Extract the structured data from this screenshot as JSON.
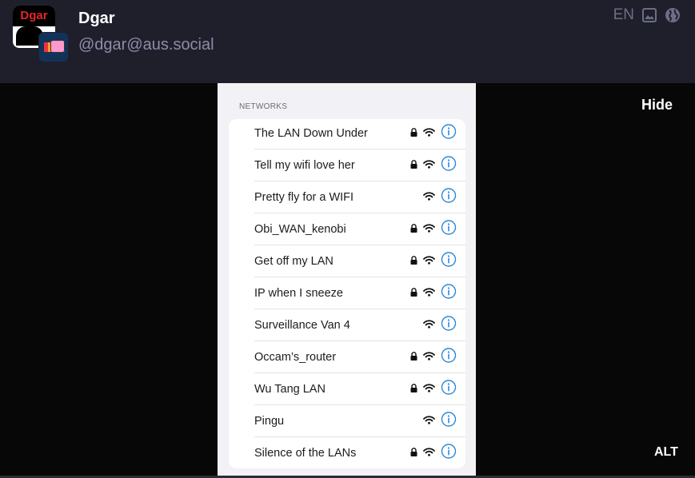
{
  "post": {
    "display_name": "Dgar",
    "account": "@dgar@aus.social",
    "avatar_text": "Dgar",
    "language": "EN"
  },
  "media": {
    "hide_label": "Hide",
    "alt_label": "ALT",
    "section_label": "NETWORKS",
    "networks": [
      {
        "name": "The LAN Down Under",
        "locked": true
      },
      {
        "name": "Tell my wifi love her",
        "locked": true
      },
      {
        "name": "Pretty fly for a WIFI",
        "locked": false
      },
      {
        "name": "Obi_WAN_kenobi",
        "locked": true
      },
      {
        "name": "Get off my LAN",
        "locked": true
      },
      {
        "name": "IP when I sneeze",
        "locked": true
      },
      {
        "name": "Surveillance Van 4",
        "locked": false
      },
      {
        "name": "Occam’s_router",
        "locked": true
      },
      {
        "name": "Wu Tang LAN",
        "locked": true
      },
      {
        "name": "Pingu",
        "locked": false
      },
      {
        "name": "Silence of the LANs",
        "locked": true
      }
    ]
  },
  "colors": {
    "header_bg": "#1f1f2c",
    "media_bg": "#070707",
    "ios_blue": "#2f88d8",
    "muted_text": "#8b8da6"
  }
}
